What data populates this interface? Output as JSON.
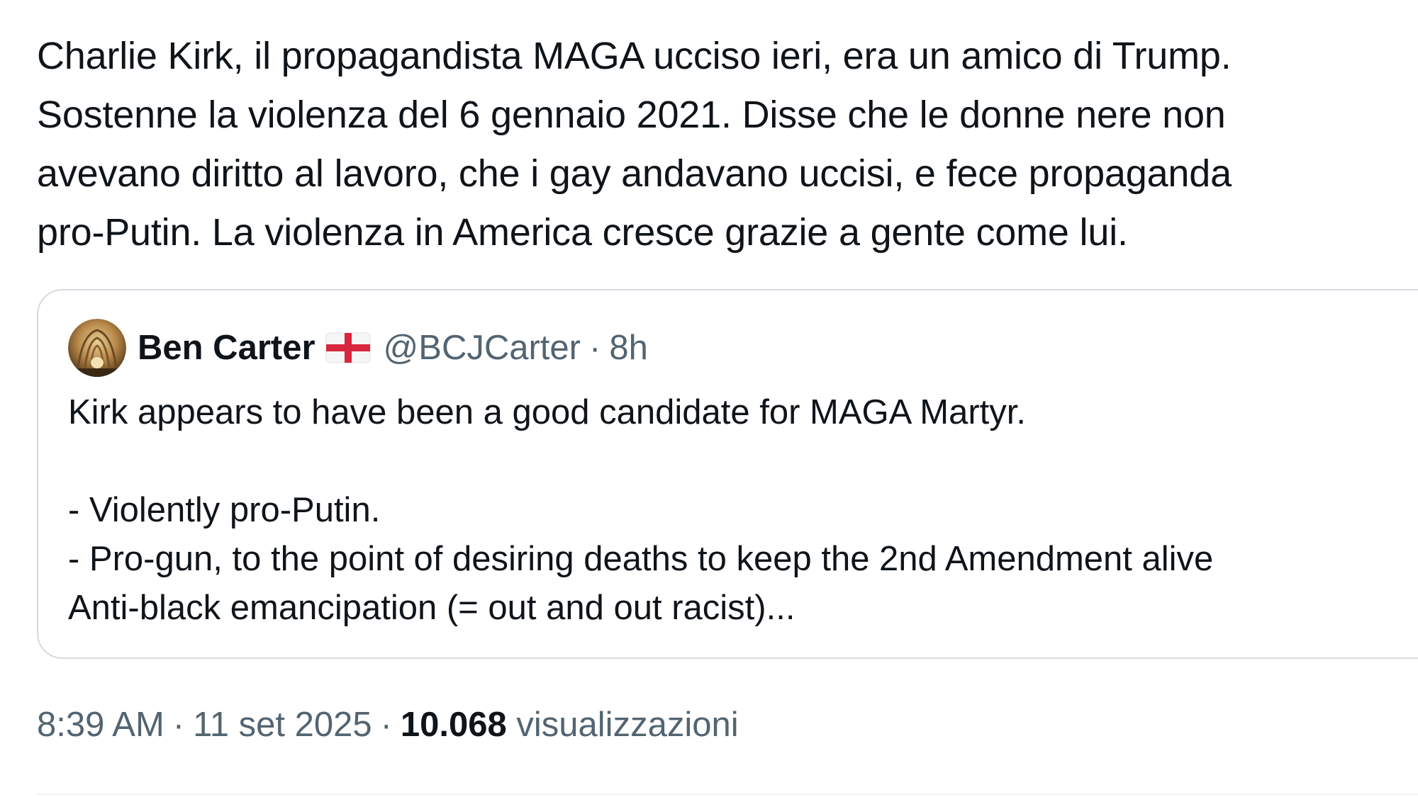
{
  "tweet": {
    "text_lines": [
      "Charlie Kirk, il propagandista MAGA ucciso ieri, era un amico di Trump.",
      "Sostenne la violenza del 6 gennaio 2021. Disse che le donne nere non",
      "avevano diritto al lavoro, che i gay andavano uccisi, e fece propaganda",
      "pro-Putin. La violenza in America cresce grazie a gente come lui."
    ],
    "meta": {
      "time": "8:39 AM",
      "separator": "·",
      "date": "11 set 2025",
      "views_count": "10.068",
      "views_label": "visualizzazioni"
    }
  },
  "quoted_tweet": {
    "avatar_icon": "avatar-image",
    "author_name": "Ben Carter",
    "flag_icon": "england-flag-icon",
    "handle": "@BCJCarter",
    "separator": "·",
    "age": "8h",
    "body_lines": [
      "Kirk appears to have been a good candidate for MAGA Martyr.",
      "",
      "- Violently pro-Putin.",
      "- Pro-gun, to the point of desiring deaths to keep the 2nd Amendment alive",
      "Anti-black emancipation (= out and out racist)..."
    ]
  },
  "colors": {
    "text_primary": "#0f1419",
    "text_secondary": "#536471",
    "card_border": "#d5dbe0",
    "flag_red": "#d7263d"
  }
}
